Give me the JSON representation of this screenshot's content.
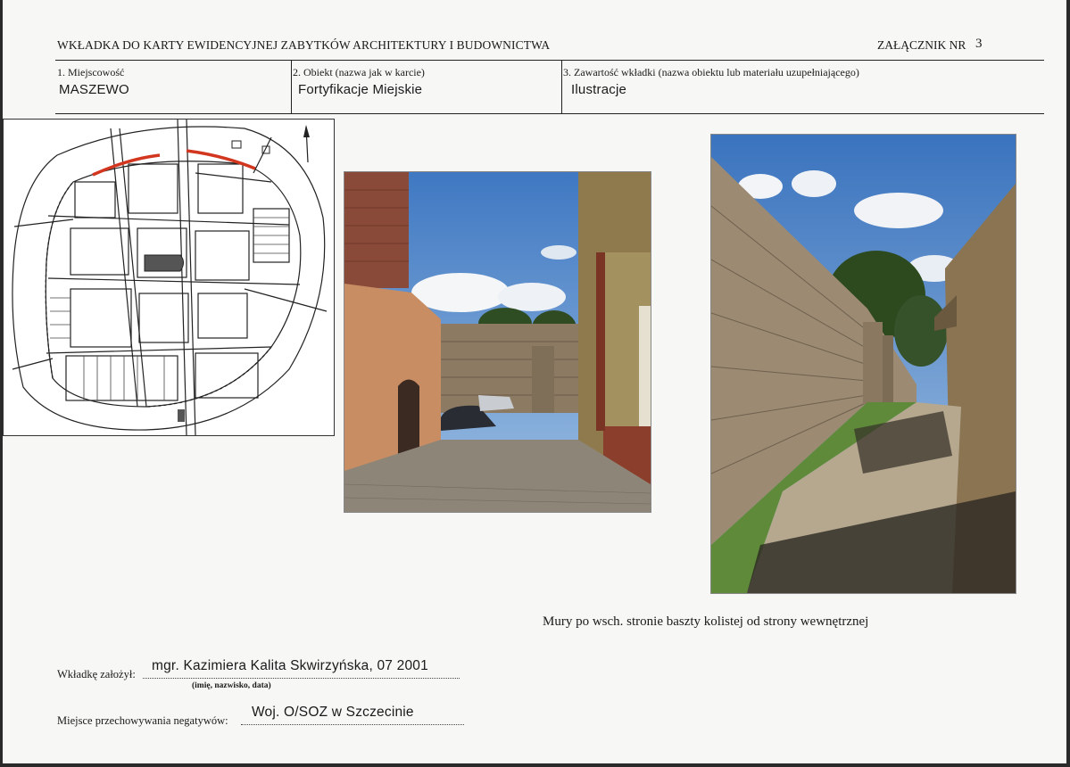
{
  "header": {
    "title": "WKŁADKA DO KARTY EWIDENCYJNEJ ZABYTKÓW ARCHITEKTURY I BUDOWNICTWA",
    "attachment_label": "ZAŁĄCZNIK NR",
    "attachment_number": "3"
  },
  "fields": [
    {
      "label": "1. Miejscowość",
      "value": "MASZEWO"
    },
    {
      "label": "2. Obiekt (nazwa jak w karcie)",
      "value": "Fortyfikacje Miejskie"
    },
    {
      "label": "3. Zawartość wkładki (nazwa obiektu lub materiału uzupełniającego)",
      "value": "Ilustracje"
    }
  ],
  "caption": "Mury po wsch. stronie baszty kolistej od strony wewnętrznej",
  "footer": {
    "author_label": "Wkładkę założył:",
    "author_value": "mgr. Kazimiera Kalita Skwirzyńska, 07 2001",
    "author_hint": "(imię, nazwisko, data)",
    "storage_label": "Miejsce przechowywania negatywów:",
    "storage_value": "Woj. O/SOZ w Szczecinie"
  },
  "colors": {
    "wall_highlight": "#d2361f",
    "sky": "#6f9fd6",
    "brick": "#8a4a3a",
    "stone": "#9c8a72"
  }
}
